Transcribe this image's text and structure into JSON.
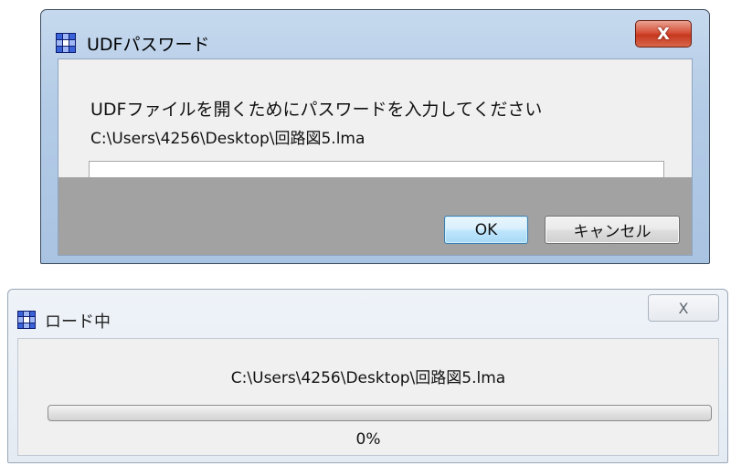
{
  "password_dialog": {
    "title": "UDFパスワード",
    "close_glyph": "X",
    "message": "UDFファイルを開くためにパスワードを入力してください",
    "file_path": "C:\\Users\\4256\\Desktop\\回路図5.lma",
    "password_value": "",
    "ok_label": "OK",
    "cancel_label": "キャンセル",
    "icon": "app-grid-icon"
  },
  "loading_dialog": {
    "title": "ロード中",
    "close_glyph": "X",
    "file_path": "C:\\Users\\4256\\Desktop\\回路図5.lma",
    "progress_percent": 0,
    "progress_text": "0%",
    "icon": "app-grid-icon"
  },
  "colors": {
    "close_button_red": "#c6381f",
    "ok_button_blue": "#bee6fd",
    "footer_gray": "#a2a2a2"
  }
}
